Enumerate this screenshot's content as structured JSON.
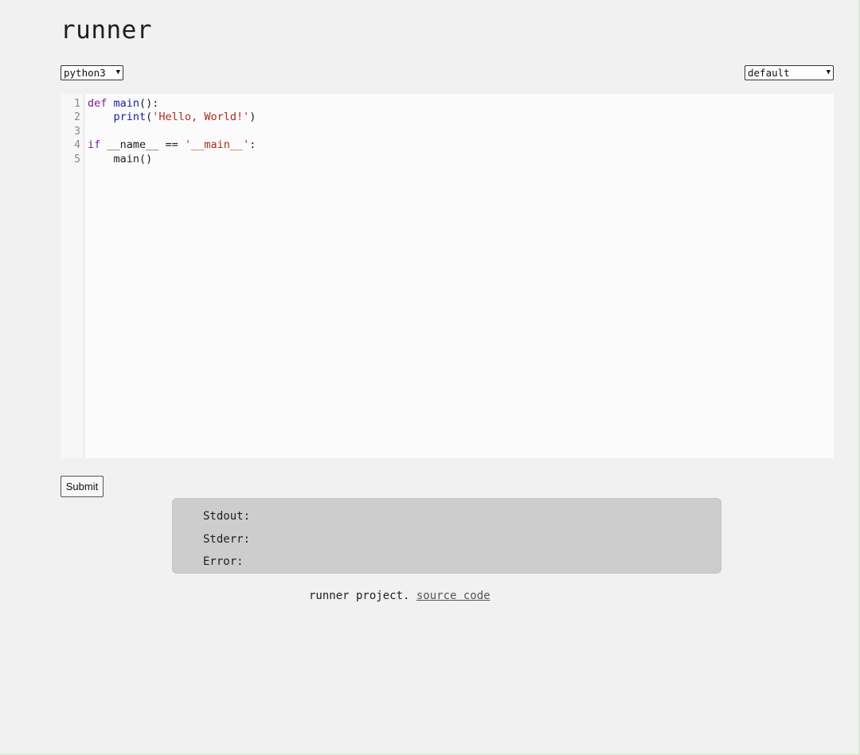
{
  "app": {
    "title": "runner"
  },
  "language_select": {
    "value": "python3"
  },
  "theme_select": {
    "value": "default"
  },
  "editor": {
    "line_numbers": [
      "1",
      "2",
      "3",
      "4",
      "5"
    ]
  },
  "submit": {
    "label": "Submit"
  },
  "output": {
    "stdout_label": "Stdout:",
    "stderr_label": "Stderr:",
    "error_label": "Error:"
  },
  "footer": {
    "text": "runner project.",
    "link_label": "source code"
  },
  "colors": {
    "keyword": "#7a1f9a",
    "function": "#1f1aa6",
    "string": "#b22a1a",
    "output_bg": "#cdcdcd"
  }
}
